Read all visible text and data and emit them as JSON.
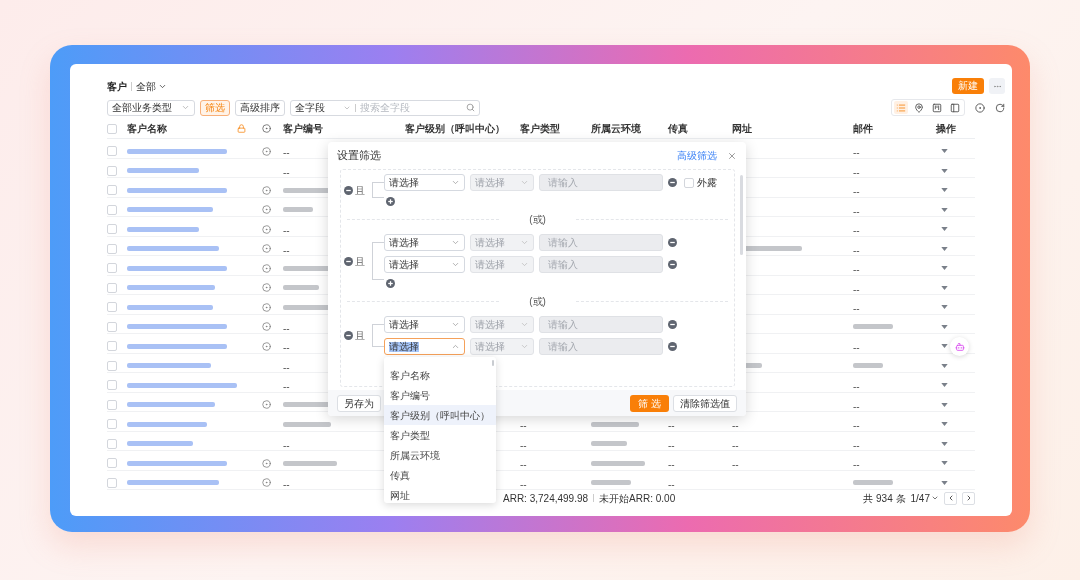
{
  "header": {
    "title": "客户",
    "view": "全部"
  },
  "toolbar": {
    "business_type": "全部业务类型",
    "filter_button": {
      "label": "筛选",
      "selected": true
    },
    "sort_button": "高级排序",
    "search": {
      "scope": "全字段",
      "placeholder": "搜索全字段"
    },
    "new_button": "新建"
  },
  "view_modes": [
    {
      "kind": "list",
      "selected": true
    },
    {
      "kind": "pin",
      "selected": false
    },
    {
      "kind": "board",
      "selected": false
    },
    {
      "kind": "panel",
      "selected": false
    }
  ],
  "table": {
    "header_checked": false,
    "columns": [
      {
        "kind": "text",
        "label": "客户名称"
      },
      {
        "kind": "lock"
      },
      {
        "kind": "target"
      },
      {
        "kind": "text",
        "label": "客户编号"
      },
      {
        "kind": "text",
        "label": "客户级别（呼叫中心）"
      },
      {
        "kind": "text",
        "label": "客户类型"
      },
      {
        "kind": "text",
        "label": "所属云环境"
      },
      {
        "kind": "text",
        "label": "传真"
      },
      {
        "kind": "text",
        "label": "网址"
      },
      {
        "kind": "text",
        "label": "邮件"
      },
      {
        "kind": "text",
        "label": "操作"
      }
    ],
    "rows": [
      {
        "checked": false,
        "name": {
          "kind": "redacted"
        },
        "target_icon": true,
        "code": "--",
        "email": "--"
      },
      {
        "checked": false,
        "name": {
          "kind": "redacted"
        },
        "target_icon": false,
        "code": "--",
        "email": "--"
      },
      {
        "checked": false,
        "name": {
          "kind": "redacted"
        },
        "target_icon": true,
        "code": {
          "kind": "redacted"
        },
        "email": "--"
      },
      {
        "checked": false,
        "name": {
          "kind": "redacted"
        },
        "target_icon": true,
        "code": {
          "kind": "redacted"
        },
        "email": "--"
      },
      {
        "checked": false,
        "name": {
          "kind": "redacted"
        },
        "target_icon": true,
        "code": "--",
        "email": "--"
      },
      {
        "checked": false,
        "name": {
          "kind": "redacted"
        },
        "target_icon": true,
        "code": "--",
        "website": {
          "kind": "redacted"
        },
        "email": "--"
      },
      {
        "checked": false,
        "name": {
          "kind": "redacted"
        },
        "target_icon": true,
        "code": {
          "kind": "redacted"
        },
        "email": "--"
      },
      {
        "checked": false,
        "name": {
          "kind": "redacted"
        },
        "target_icon": true,
        "code": {
          "kind": "redacted"
        },
        "email": "--"
      },
      {
        "checked": false,
        "name": {
          "kind": "redacted"
        },
        "target_icon": true,
        "code": {
          "kind": "redacted"
        },
        "email": "--"
      },
      {
        "checked": false,
        "name": {
          "kind": "redacted"
        },
        "target_icon": true,
        "code": "--",
        "email": {
          "kind": "redacted"
        }
      },
      {
        "checked": false,
        "name": {
          "kind": "redacted"
        },
        "target_icon": true,
        "code": "--",
        "email": "--"
      },
      {
        "checked": false,
        "name": {
          "kind": "redacted"
        },
        "target_icon": false,
        "code": "--",
        "website": {
          "kind": "redacted"
        },
        "email": {
          "kind": "redacted"
        }
      },
      {
        "checked": false,
        "name": {
          "kind": "redacted"
        },
        "target_icon": false,
        "code": "--",
        "email": "--"
      },
      {
        "checked": false,
        "name": {
          "kind": "redacted"
        },
        "target_icon": true,
        "code": {
          "kind": "redacted"
        },
        "email": "--"
      },
      {
        "checked": false,
        "name": {
          "kind": "redacted"
        },
        "target_icon": false,
        "code": {
          "kind": "redacted"
        },
        "type": "--",
        "cloud": {
          "kind": "redacted"
        },
        "fax": "--",
        "website": "--",
        "email": "--"
      },
      {
        "checked": false,
        "name": {
          "kind": "redacted"
        },
        "target_icon": false,
        "code": "--",
        "type": "--",
        "cloud": {
          "kind": "redacted"
        },
        "fax": "--",
        "website": "--",
        "email": "--"
      },
      {
        "checked": false,
        "name": {
          "kind": "redacted"
        },
        "target_icon": true,
        "code": {
          "kind": "redacted"
        },
        "type": "--",
        "cloud": {
          "kind": "redacted"
        },
        "fax": "--",
        "website": "--",
        "email": "--"
      },
      {
        "checked": false,
        "name": {
          "kind": "redacted"
        },
        "target_icon": true,
        "code": "--",
        "type": "--",
        "cloud": {
          "kind": "redacted"
        },
        "fax": "--",
        "email": {
          "kind": "redacted"
        }
      }
    ]
  },
  "summary": [
    "ARR: 3,724,499.98",
    "未开始ARR: 0.00"
  ],
  "pagination": {
    "total": "共 934 条",
    "page": "1/47"
  },
  "filter_dialog": {
    "title": "设置筛选",
    "advanced_link": "高级筛选",
    "groups": [
      {
        "join": "且",
        "add_button": true,
        "conditions": [
          {
            "field": "请选择",
            "operator": "请选择",
            "value_placeholder": "请输入",
            "focused": false,
            "expose": {
              "label": "外露",
              "checked": false
            }
          }
        ]
      },
      {
        "separator": "(或)",
        "join": "且",
        "add_button": true,
        "conditions": [
          {
            "field": "请选择",
            "operator": "请选择",
            "value_placeholder": "请输入",
            "focused": false
          },
          {
            "field": "请选择",
            "operator": "请选择",
            "value_placeholder": "请输入",
            "focused": false
          }
        ]
      },
      {
        "separator": "(或)",
        "join": "且",
        "add_button": false,
        "conditions": [
          {
            "field": "请选择",
            "operator": "请选择",
            "value_placeholder": "请输入",
            "focused": false
          },
          {
            "field": "请选择",
            "operator": "请选择",
            "value_placeholder": "请输入",
            "focused": true,
            "options": [
              {
                "label": "客户名称",
                "selected": false
              },
              {
                "label": "客户编号",
                "selected": false
              },
              {
                "label": "客户级别（呼叫中心）",
                "selected": true
              },
              {
                "label": "客户类型",
                "selected": false
              },
              {
                "label": "所属云环境",
                "selected": false
              },
              {
                "label": "传真",
                "selected": false
              },
              {
                "label": "网址",
                "selected": false
              }
            ]
          }
        ]
      }
    ],
    "save_as": "另存为",
    "apply": "筛 选",
    "clear": "清除筛选值"
  }
}
